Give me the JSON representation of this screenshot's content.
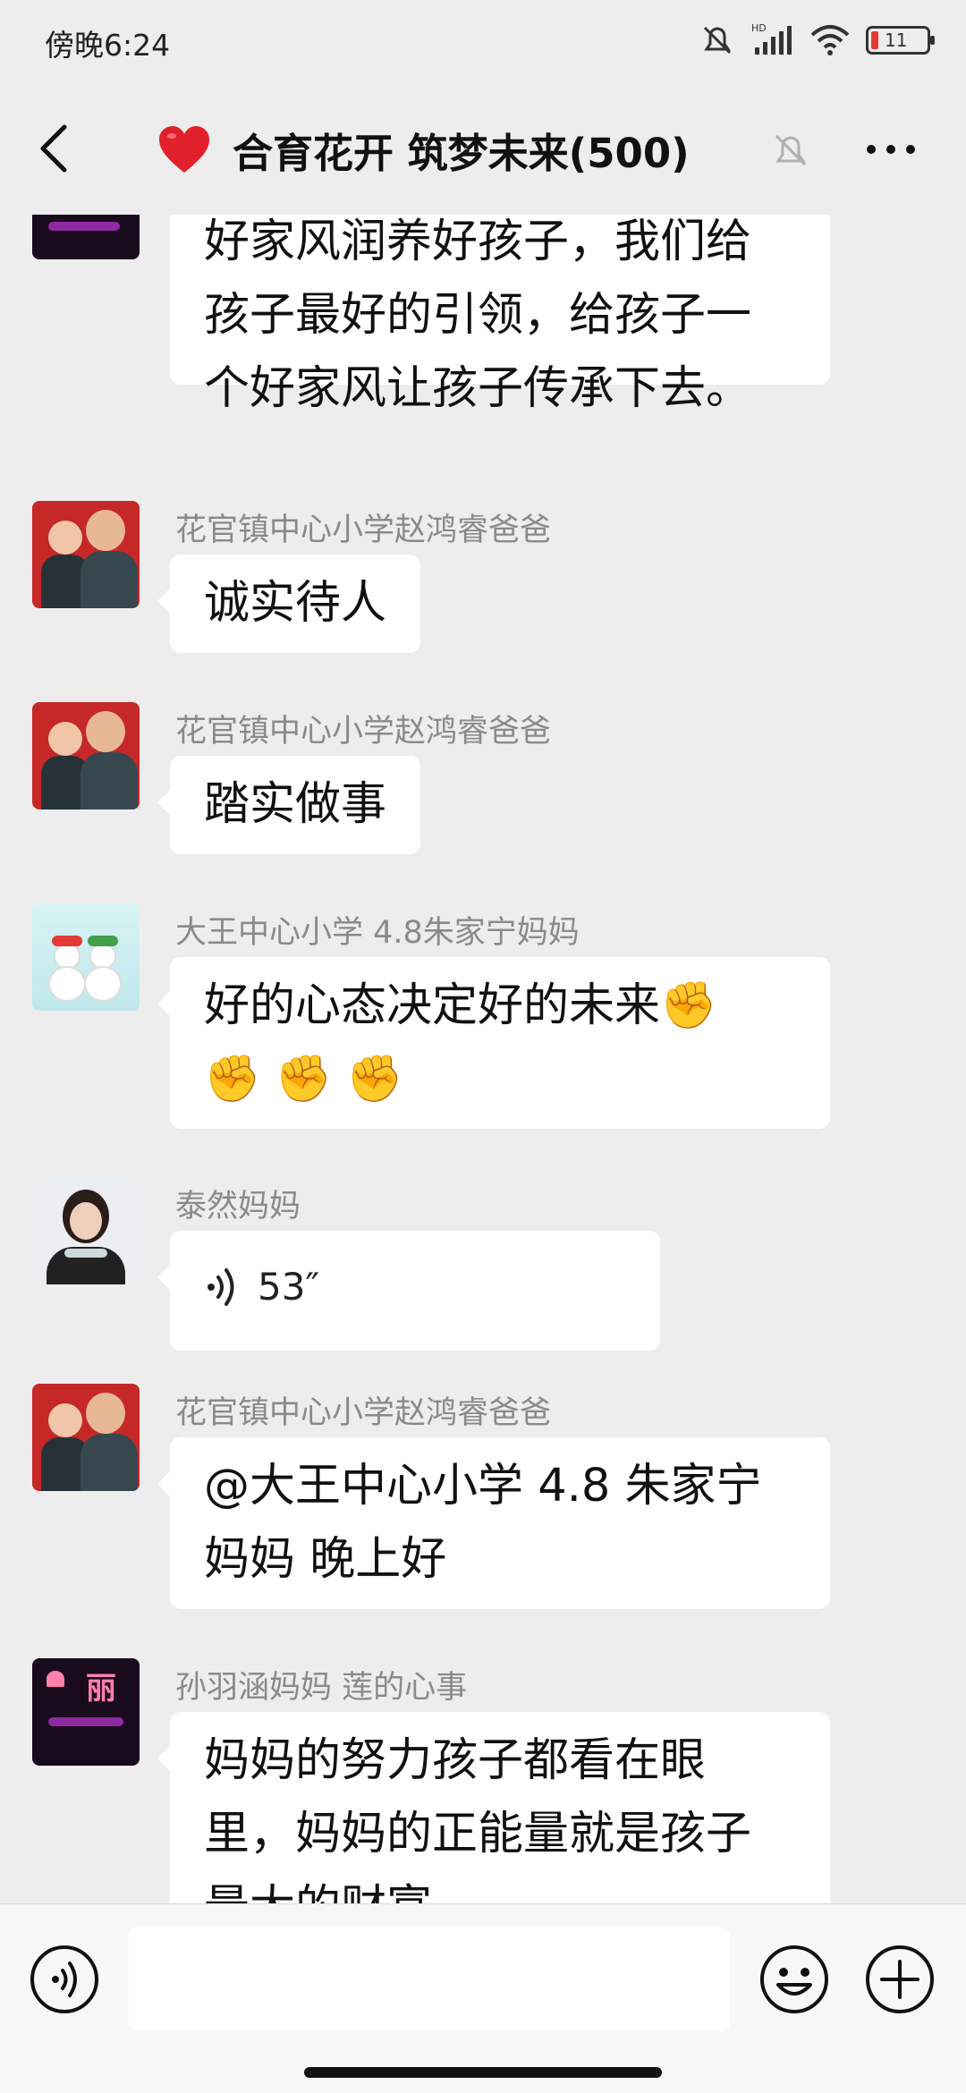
{
  "status": {
    "time": "傍晚6:24",
    "battery": "11"
  },
  "header": {
    "title": "合育花开 筑梦未来(500)"
  },
  "messages": [
    {
      "sender": "",
      "lines": [
        "好家风润养好孩子，我们给",
        "孩子最好的引领，给孩子一",
        "个好家风让孩子传承下去。"
      ]
    },
    {
      "sender": "花官镇中心小学赵鸿睿爸爸",
      "lines": [
        "诚实待人"
      ]
    },
    {
      "sender": "花官镇中心小学赵鸿睿爸爸",
      "lines": [
        "踏实做事"
      ]
    },
    {
      "sender": "大王中心小学 4.8朱家宁妈妈",
      "lines": [
        "好的心态决定好的未来✊",
        "✊ ✊ ✊"
      ]
    },
    {
      "sender": "泰然妈妈",
      "voice_duration": "53″"
    },
    {
      "sender": "花官镇中心小学赵鸿睿爸爸",
      "lines": [
        "@大王中心小学 4.8 朱家宁",
        "妈妈  晚上好"
      ]
    },
    {
      "sender": "孙羽涵妈妈  莲的心事",
      "avatar_text": "丽",
      "lines": [
        "妈妈的努力孩子都看在眼",
        "里，妈妈的正能量就是孩子",
        "最大的财富"
      ]
    }
  ],
  "colors": {
    "background": "#ededed",
    "bubble": "#ffffff",
    "sender": "#8a8a8a"
  },
  "icons": [
    "back-arrow-icon",
    "heart-icon",
    "mute-bell-icon",
    "more-icon",
    "voice-icon",
    "emoji-icon",
    "plus-icon"
  ]
}
